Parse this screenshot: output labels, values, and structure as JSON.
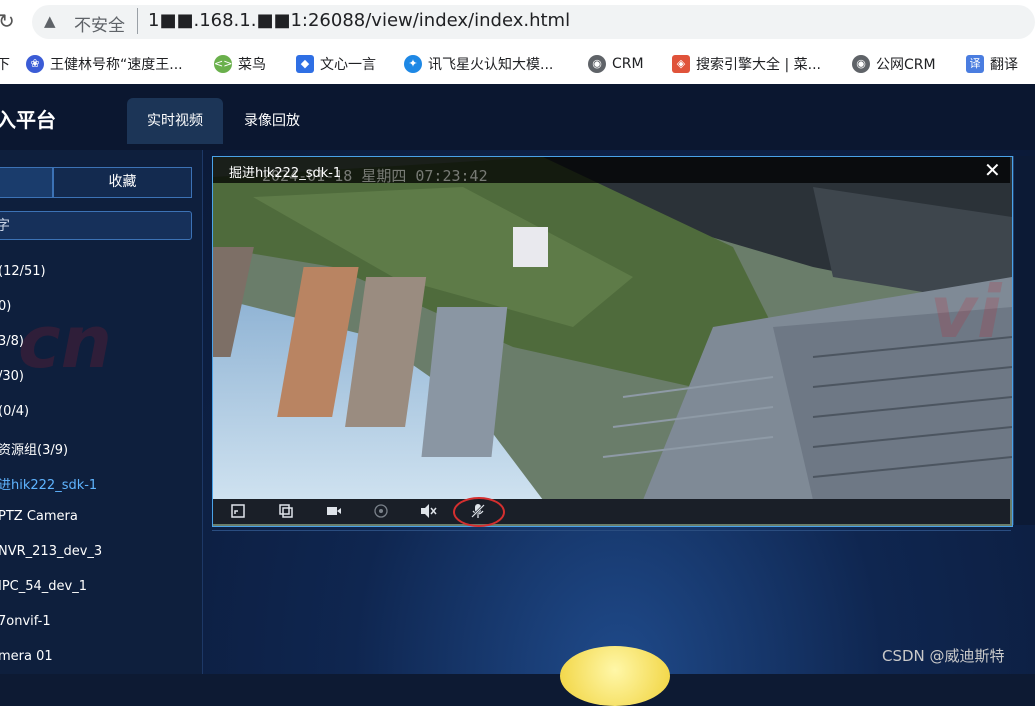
{
  "browser": {
    "insecure_label": "不安全",
    "url": "1■■.168.1.■■1:26088/view/index/index.html",
    "bookmarks": [
      {
        "label": "王健林号称“速度王...",
        "icon": "paw-icon",
        "color": "#3b5cd6"
      },
      {
        "label": "菜鸟",
        "icon": "runoob-icon",
        "color": "#6ab04c"
      },
      {
        "label": "文心一言",
        "icon": "wenxin-icon",
        "color": "#2f6fe4"
      },
      {
        "label": "讯飞星火认知大模...",
        "icon": "spark-icon",
        "color": "#1e88e5"
      },
      {
        "label": "CRM",
        "icon": "globe-icon",
        "color": "#5f6368"
      },
      {
        "label": "搜索引擎大全 | 菜...",
        "icon": "cube-icon",
        "color": "#e0533a"
      },
      {
        "label": "公网CRM",
        "icon": "globe-icon",
        "color": "#5f6368"
      },
      {
        "label": "翻译",
        "icon": "translate-icon",
        "color": "#4a7de0"
      }
    ],
    "first_bookmark_fragment": "下"
  },
  "app": {
    "title": "入平台",
    "tabs": [
      "实时视频",
      "录像回放"
    ]
  },
  "sidebar": {
    "tabs": [
      "",
      "收藏"
    ],
    "search_fragment": "字",
    "tree": [
      {
        "label": "(12/51)",
        "active": false
      },
      {
        "label": "0)",
        "active": false
      },
      {
        "label": "3/8)",
        "active": false
      },
      {
        "label": "/30)",
        "active": false
      },
      {
        "label": "(0/4)",
        "active": false
      },
      {
        "label": "资源组(3/9)",
        "active": false
      },
      {
        "label": "进hik222_sdk-1",
        "active": true
      },
      {
        "label": "PTZ Camera",
        "active": false
      },
      {
        "label": "NVR_213_dev_3",
        "active": false
      },
      {
        "label": "IPC_54_dev_1",
        "active": false
      },
      {
        "label": "7onvif-1",
        "active": false
      },
      {
        "label": "mera 01",
        "active": false
      }
    ]
  },
  "player": {
    "title": "掘进hik222_sdk-1",
    "osd": "2024-01-18  星期四  07:23:42",
    "toolbar_icons": [
      "fullscreen-icon",
      "copy-window-icon",
      "record-video-icon",
      "ptz-target-icon",
      "mute-speaker-icon",
      "microphone-off-icon"
    ],
    "highlighted_icon": "microphone-off-icon"
  },
  "watermarks": [
    "cn",
    "vi"
  ],
  "footer_watermark": "CSDN @威迪斯特"
}
